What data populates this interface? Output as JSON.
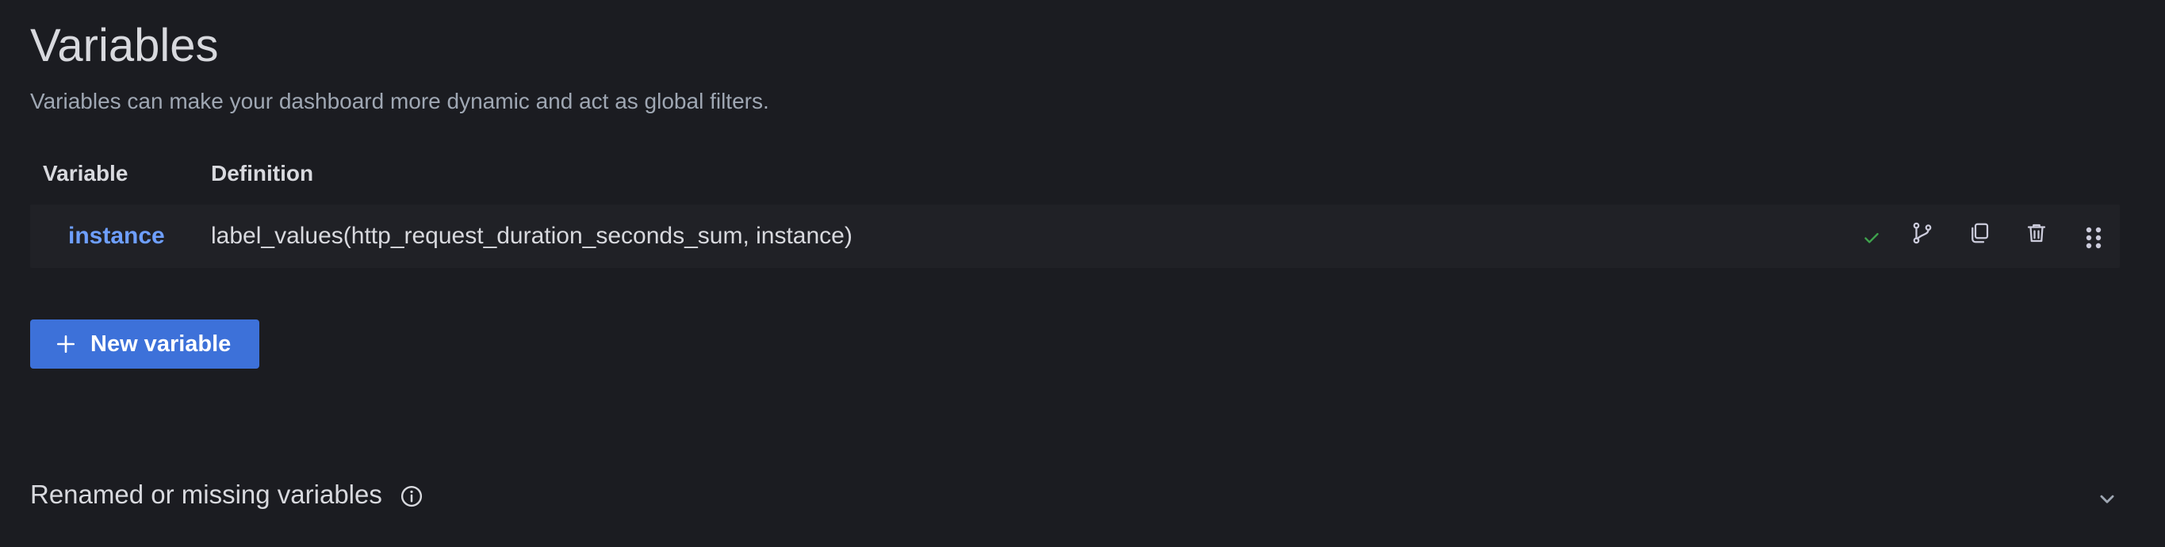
{
  "header": {
    "title": "Variables",
    "subtitle": "Variables can make your dashboard more dynamic and act as global filters."
  },
  "table": {
    "columns": [
      "Variable",
      "Definition"
    ],
    "rows": [
      {
        "name": "instance",
        "definition": "label_values(http_request_duration_seconds_sum, instance)",
        "status": "check-icon",
        "actions": [
          "duplicate-icon",
          "copy-icon",
          "trash-icon",
          "drag-handle-icon"
        ]
      }
    ]
  },
  "new_variable_button": {
    "label": "New variable",
    "icon": "plus-icon"
  },
  "renamed_section": {
    "label": "Renamed or missing variables",
    "info_icon": "info-icon",
    "toggle_icon": "chevron-down-icon"
  },
  "colors": {
    "background": "#1b1c21",
    "row_background": "#202126",
    "link": "#6e9fff",
    "primary_button": "#3d71d9",
    "success": "#3fa34d"
  }
}
